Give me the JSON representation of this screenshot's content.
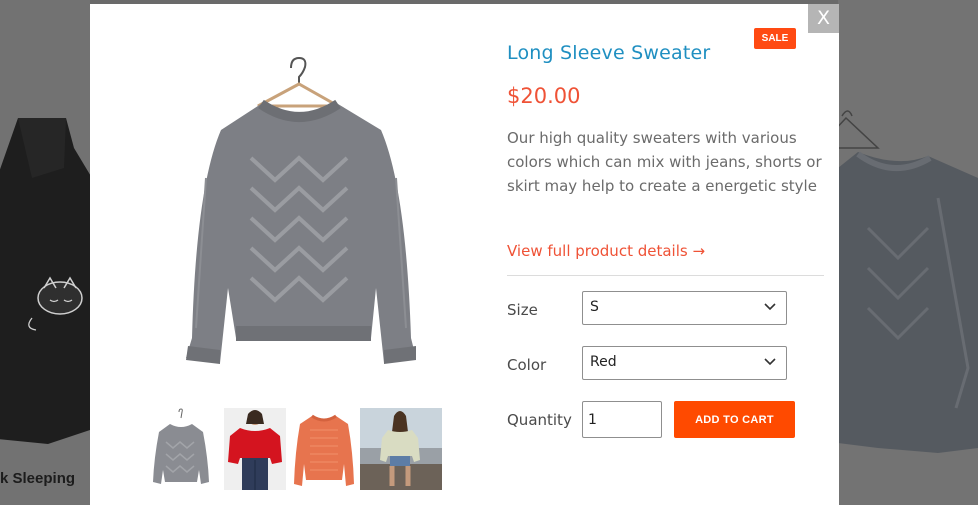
{
  "background": {
    "left_product_title": "k Sleeping",
    "right_mark": "."
  },
  "modal": {
    "close_label": "X",
    "sale_badge": "SALE",
    "title": "Long Sleeve Sweater",
    "price": "$20.00",
    "description": "Our high quality sweaters with various colors which can mix with jeans, shorts or skirt may help to create a energetic style",
    "details_link": "View full product details →",
    "size_label": "Size",
    "size_value": "S",
    "color_label": "Color",
    "color_value": "Red",
    "quantity_label": "Quantity",
    "quantity_value": "1",
    "add_to_cart": "ADD TO CART"
  },
  "colors": {
    "accent": "#ef5236",
    "title_blue": "#1f8fc1",
    "button": "#ff4a00"
  },
  "icons": [
    "close-icon",
    "chevron-down-icon",
    "hanger-icon"
  ]
}
